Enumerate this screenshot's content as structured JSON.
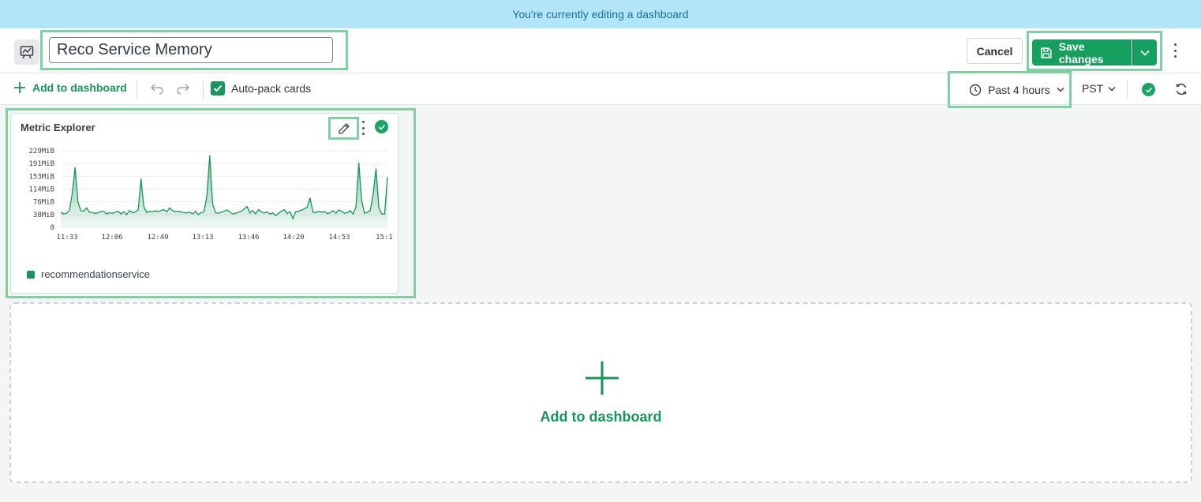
{
  "banner": {
    "text": "You're currently editing a dashboard"
  },
  "header": {
    "dashboard_icon": "chart-icon",
    "title_value": "Reco Service Memory",
    "cancel_label": "Cancel",
    "save_label": "Save changes"
  },
  "toolbar": {
    "add_label": "Add to dashboard",
    "autopack_label": "Auto-pack cards",
    "autopack_checked": true,
    "time_range": "Past 4 hours",
    "timezone": "PST"
  },
  "card": {
    "title": "Metric Explorer",
    "legend": "recommendationservice"
  },
  "chart_data": {
    "type": "area",
    "y_ticks": [
      "229MiB",
      "191MiB",
      "153MiB",
      "114MiB",
      "76MiB",
      "38MiB",
      "0"
    ],
    "x_ticks": [
      "11:33",
      "12:06",
      "12:40",
      "13:13",
      "13:46",
      "14:20",
      "14:53",
      "15:1"
    ],
    "ylim": [
      0,
      229
    ],
    "series": [
      {
        "name": "recommendationservice",
        "color": "#17955a",
        "values": [
          45,
          40,
          42,
          50,
          100,
          180,
          75,
          50,
          48,
          58,
          45,
          44,
          42,
          43,
          48,
          47,
          40,
          44,
          42,
          45,
          48,
          40,
          47,
          38,
          50,
          44,
          46,
          52,
          145,
          62,
          44,
          48,
          46,
          49,
          47,
          50,
          53,
          46,
          58,
          50,
          47,
          48,
          46,
          44,
          43,
          45,
          40,
          48,
          38,
          44,
          46,
          95,
          215,
          70,
          44,
          42,
          45,
          48,
          52,
          46,
          40,
          42,
          45,
          48,
          55,
          62,
          43,
          50,
          40,
          53,
          46,
          43,
          46,
          40,
          43,
          35,
          42,
          48,
          53,
          41,
          47,
          26,
          47,
          48,
          52,
          55,
          60,
          88,
          45,
          44,
          48,
          45,
          47,
          41,
          44,
          50,
          42,
          52,
          48,
          42,
          44,
          50,
          40,
          60,
          193,
          80,
          42,
          45,
          50,
          98,
          176,
          60,
          40,
          40,
          150
        ]
      }
    ]
  },
  "dropzone": {
    "label": "Add to dashboard"
  }
}
